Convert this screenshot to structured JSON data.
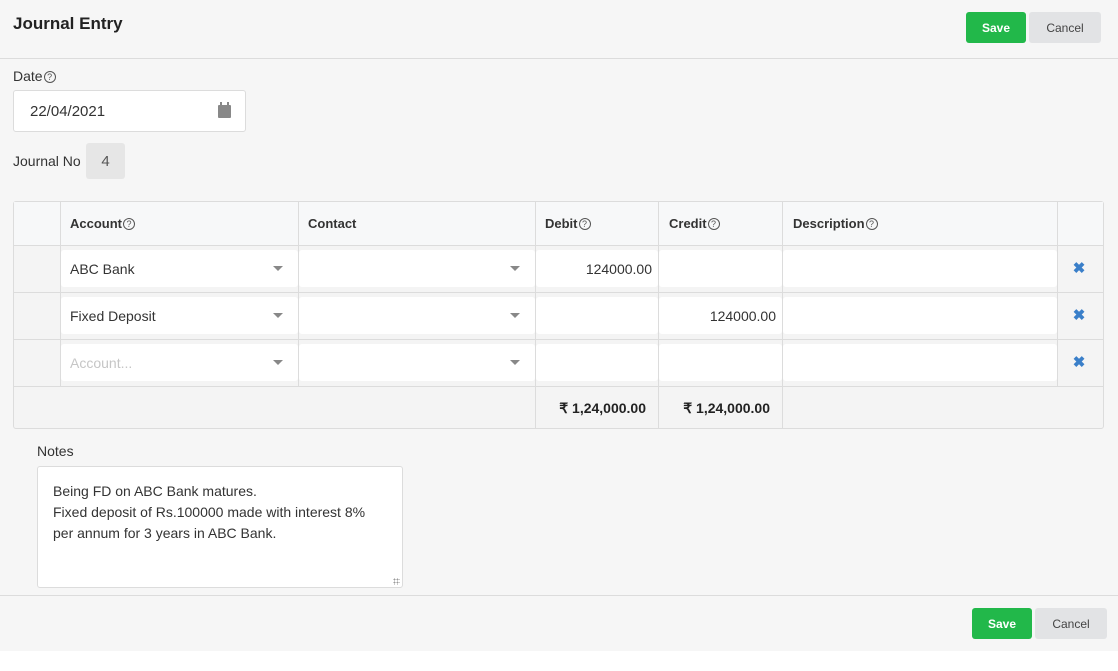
{
  "header": {
    "title": "Journal Entry",
    "save_label": "Save",
    "cancel_label": "Cancel"
  },
  "form": {
    "date_label": "Date",
    "date_value": "22/04/2021",
    "journal_no_label": "Journal No",
    "journal_no_value": "4"
  },
  "table": {
    "columns": {
      "account": "Account",
      "contact": "Contact",
      "debit": "Debit",
      "credit": "Credit",
      "description": "Description"
    },
    "rows": [
      {
        "account": "ABC Bank",
        "contact": "",
        "debit": "124000.00",
        "credit": "",
        "description": ""
      },
      {
        "account": "Fixed Deposit",
        "contact": "",
        "debit": "",
        "credit": "124000.00",
        "description": ""
      },
      {
        "account": "",
        "account_placeholder": "Account...",
        "contact": "",
        "debit": "",
        "credit": "",
        "description": ""
      }
    ],
    "totals": {
      "debit": "₹ 1,24,000.00",
      "credit": "₹ 1,24,000.00"
    }
  },
  "notes": {
    "label": "Notes",
    "value": "Being FD on ABC Bank matures.\nFixed deposit of Rs.100000 made with interest 8%\nper annum for 3 years in ABC Bank."
  },
  "footer": {
    "save_label": "Save",
    "cancel_label": "Cancel"
  },
  "icons": {
    "help": "?",
    "delete": "✖"
  },
  "colors": {
    "save": "#22b84a",
    "cancel": "#e2e3e5",
    "delete_icon": "#3a7fc9"
  }
}
